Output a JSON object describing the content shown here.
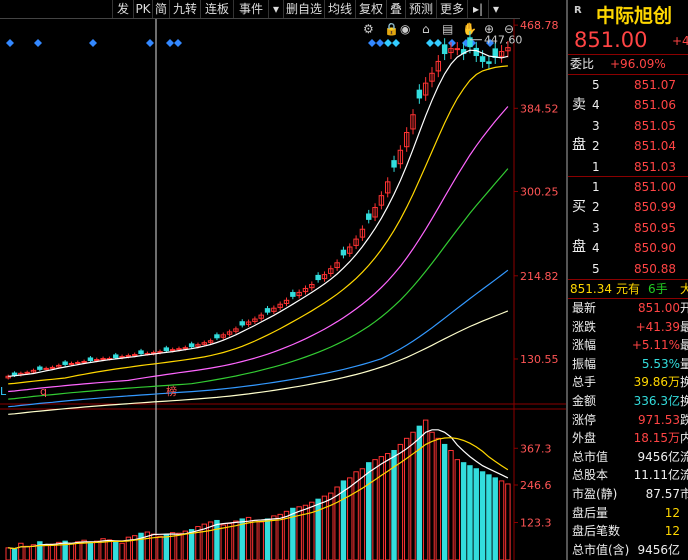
{
  "toolbar": {
    "items": [
      "发",
      "PK",
      "简",
      "九转",
      "连板",
      "事件",
      "▾",
      "删自选",
      "均线",
      "复权",
      "叠",
      "预测",
      "更多",
      "▸|",
      "▾"
    ],
    "icons": [
      "gear-icon",
      "lock-icon",
      "eye-icon",
      "cart-icon",
      "print-icon",
      "hand-icon",
      "zoom-in-icon",
      "zoom-out-icon"
    ]
  },
  "stock": {
    "badge": "R",
    "name": "中际旭创",
    "price": "851.00",
    "change_short": "+41",
    "weibi_label": "委比",
    "weibi_value": "+96.09%"
  },
  "order_book": {
    "sell_label": [
      "卖",
      "盘"
    ],
    "buy_label": [
      "买",
      "盘"
    ],
    "sell": [
      {
        "level": "5",
        "price": "851.07"
      },
      {
        "level": "4",
        "price": "851.06"
      },
      {
        "level": "3",
        "price": "851.05"
      },
      {
        "level": "2",
        "price": "851.04"
      },
      {
        "level": "1",
        "price": "851.03"
      }
    ],
    "buy": [
      {
        "level": "1",
        "price": "851.00"
      },
      {
        "level": "2",
        "price": "850.99"
      },
      {
        "level": "3",
        "price": "850.95"
      },
      {
        "level": "4",
        "price": "850.90"
      },
      {
        "level": "5",
        "price": "850.88"
      }
    ]
  },
  "trade_line": {
    "price": "851.34",
    "unit": "元有",
    "hands": "6手",
    "tail": "大"
  },
  "stats": [
    {
      "label": "最新",
      "value": "851.00",
      "tail": "开",
      "color": "#ff4444"
    },
    {
      "label": "涨跌",
      "value": "+41.39",
      "tail": "最",
      "color": "#ff4444"
    },
    {
      "label": "涨幅",
      "value": "+5.11%",
      "tail": "最",
      "color": "#ff4444"
    },
    {
      "label": "振幅",
      "value": "5.53%",
      "tail": "量",
      "color": "#33dddd"
    },
    {
      "label": "总手",
      "value": "39.86万",
      "tail": "换",
      "color": "#ffd700"
    },
    {
      "label": "金额",
      "value": "336.3亿",
      "tail": "换",
      "color": "#33dddd"
    },
    {
      "label": "涨停",
      "value": "971.53",
      "tail": "跌",
      "color": "#ff4444"
    },
    {
      "label": "外盘",
      "value": "18.15万",
      "tail": "内",
      "color": "#ff4444"
    },
    {
      "label": "总市值",
      "value": "9456亿",
      "tail": "流",
      "color": "#eeeeee"
    },
    {
      "label": "总股本",
      "value": "11.11亿",
      "tail": "流",
      "color": "#eeeeee"
    },
    {
      "label": "市盈(静)",
      "value": "87.57",
      "tail": "市",
      "color": "#eeeeee"
    },
    {
      "label": "盘后量",
      "value": "12",
      "tail": "",
      "color": "#ffd700"
    },
    {
      "label": "盘后笔数",
      "value": "12",
      "tail": "",
      "color": "#ffd700"
    },
    {
      "label": "总市值(含)",
      "value": "9456亿",
      "tail": "",
      "color": "#eeeeee"
    }
  ],
  "chart": {
    "price_axis": [
      "468.78",
      "384.52",
      "300.25",
      "214.82",
      "130.55"
    ],
    "volume_axis": [
      "367.3",
      "246.6",
      "123.3"
    ],
    "high_label": "447.60",
    "markers": [
      "L",
      "q",
      "榜"
    ]
  },
  "chart_data": {
    "type": "candlestick",
    "ylim": [
      90,
      475
    ],
    "close": [
      113,
      114,
      116,
      117,
      119,
      120,
      121,
      122,
      124,
      125,
      126,
      127,
      128,
      129,
      130,
      131,
      131,
      132,
      133,
      134,
      135,
      136,
      136,
      137,
      138,
      139,
      140,
      141,
      142,
      143,
      145,
      147,
      149,
      152,
      155,
      158,
      161,
      165,
      168,
      171,
      175,
      178,
      182,
      186,
      190,
      194,
      198,
      202,
      206,
      211,
      216,
      222,
      228,
      236,
      244,
      252,
      262,
      272,
      284,
      296,
      310,
      325,
      342,
      360,
      378,
      395,
      410,
      420,
      432,
      440,
      445,
      445,
      440,
      447,
      438,
      432,
      430,
      436,
      442,
      446
    ],
    "volume": [
      40,
      35,
      55,
      45,
      50,
      60,
      48,
      52,
      58,
      62,
      55,
      60,
      65,
      58,
      62,
      70,
      66,
      60,
      55,
      75,
      80,
      88,
      92,
      85,
      78,
      82,
      90,
      88,
      95,
      100,
      110,
      118,
      125,
      130,
      115,
      120,
      128,
      135,
      140,
      130,
      125,
      135,
      145,
      150,
      160,
      170,
      175,
      180,
      190,
      200,
      210,
      220,
      240,
      260,
      270,
      290,
      300,
      320,
      330,
      340,
      350,
      360,
      380,
      400,
      420,
      440,
      460,
      420,
      400,
      380,
      360,
      330,
      320,
      310,
      300,
      290,
      280,
      270,
      260,
      250
    ],
    "ma_colors": [
      "#ffffff",
      "#ffd700",
      "#ff66ff",
      "#33cc33",
      "#3399ff",
      "#ffffcc"
    ]
  }
}
